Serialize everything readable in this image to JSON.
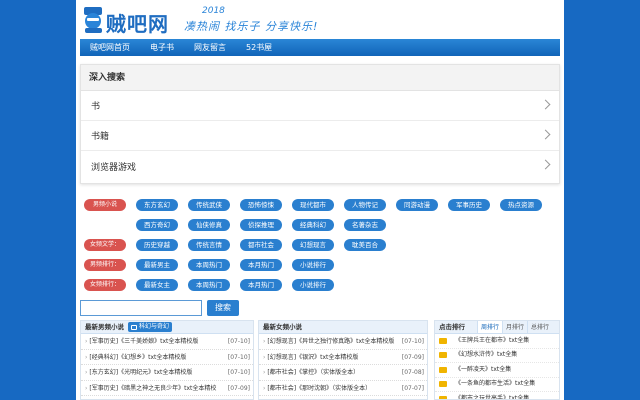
{
  "header": {
    "logo_text": "贼吧网",
    "slogan_year": "2018",
    "slogan": "凑热闹 找乐子 分享快乐!"
  },
  "nav": {
    "items": [
      {
        "label": "贼吧网首页"
      },
      {
        "label": "电子书"
      },
      {
        "label": "网友留言"
      },
      {
        "label": "52书屋"
      }
    ]
  },
  "deep_search": {
    "title": "深入搜索",
    "rows": [
      {
        "label": "书"
      },
      {
        "label": "书籍"
      },
      {
        "label": "浏览器游戏"
      }
    ]
  },
  "tag_rows": [
    {
      "label": "男频小说",
      "tags": [
        "东方玄幻",
        "传统武侠",
        "恐怖惊悚",
        "现代都市",
        "人物传记",
        "同游动漫",
        "军事历史",
        "热点资源"
      ]
    },
    {
      "label": "",
      "tags": [
        "西方奇幻",
        "仙侠修真",
        "侦探推理",
        "经典科幻",
        "名著杂志"
      ]
    },
    {
      "label": "女频文学：",
      "tags": [
        "历史穿越",
        "传统言情",
        "都市社会",
        "幻想现言",
        "耽美百合"
      ]
    },
    {
      "label": "男频排行：",
      "tags": [
        "最新男主",
        "本周热门",
        "本月热门",
        "小说排行"
      ]
    },
    {
      "label": "女频排行：",
      "tags": [
        "最新女主",
        "本周热门",
        "本月热门",
        "小说排行"
      ]
    }
  ],
  "search_bar": {
    "value": "",
    "placeholder": "",
    "button_label": "搜索"
  },
  "panel_male": {
    "title": "最新男频小说",
    "badge": "科幻与奇幻",
    "items": [
      {
        "text": "[军事历史]《三千美娇娘》txt全本精校版",
        "date": "[07-10]"
      },
      {
        "text": "[经典科幻]《幻想乡》txt全本精校版",
        "date": "[07-10]"
      },
      {
        "text": "[东方玄幻]《光明纪元》txt全本精校版",
        "date": "[07-10]"
      },
      {
        "text": "[军事历史]《暗黑之神之无良少年》txt全本精校",
        "date": "[07-09]"
      }
    ]
  },
  "panel_female": {
    "title": "最新女频小说",
    "items": [
      {
        "text": "[幻想现言]《异世之独行修真路》txt全本精校版",
        "date": "[07-10]"
      },
      {
        "text": "[幻想现言]《银沢》txt全本精校版",
        "date": "[07-09]"
      },
      {
        "text": "[都市社会]《掌控》（实体版全本）",
        "date": "[07-08]"
      },
      {
        "text": "[都市社会]《那时沈朝》（实体版全本）",
        "date": "[07-07]"
      }
    ]
  },
  "panel_rank": {
    "title": "点击排行",
    "tabs": [
      "周排行",
      "月排行",
      "总排行"
    ],
    "items": [
      {
        "text": "《王牌兵王在都市》txt全集"
      },
      {
        "text": "《幻想水浒传》txt全集"
      },
      {
        "text": "《一醉凌天》txt全集"
      },
      {
        "text": "《一条鱼的都市生活》txt全集"
      },
      {
        "text": "《都市之玩世高手》txt全集"
      }
    ]
  },
  "colors": {
    "page_background": "#1769c2",
    "nav_bar": "#1a73c6",
    "tag_blue": "#2a7fcf",
    "tag_label_red": "#d9534f",
    "rank_icon": "#f0b400"
  }
}
